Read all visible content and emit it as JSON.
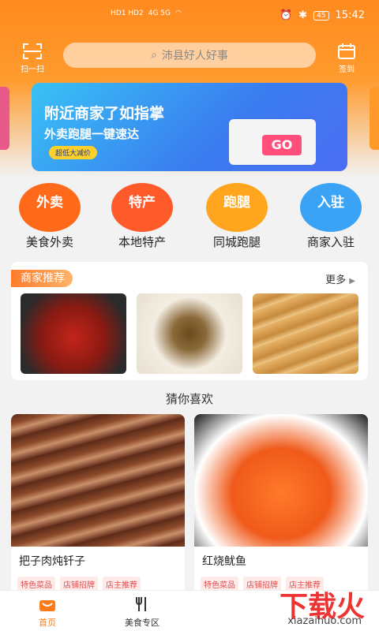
{
  "status": {
    "carrier_tags": "HD1 HD2",
    "signal": "4G 5G",
    "battery": "45",
    "time": "15:42"
  },
  "header": {
    "scan_label": "扫一扫",
    "sign_label": "签到",
    "search_placeholder": "沛县好人好事"
  },
  "banner": {
    "line1": "附近商家了如指掌",
    "line2": "外卖跑腿一键速达",
    "badge": "超低大减价",
    "go_text": "GO"
  },
  "categories": [
    {
      "circle_text": "外卖",
      "label": "美食外卖",
      "color": "#ff6a1a"
    },
    {
      "circle_text": "特产",
      "label": "本地特产",
      "color": "#ff5a2a"
    },
    {
      "circle_text": "跑腿",
      "label": "同城跑腿",
      "color": "#ffa51e"
    },
    {
      "circle_text": "入驻",
      "label": "商家入驻",
      "color": "#3aa3f5"
    }
  ],
  "merchant": {
    "title": "商家推荐",
    "more": "更多"
  },
  "guess": {
    "title": "猜你喜欢"
  },
  "cards": [
    {
      "name": "把子肉炖钎子",
      "tags": [
        "特色菜品",
        "店铺招牌",
        "店主推荐"
      ]
    },
    {
      "name": "红烧鱿鱼",
      "tags": [
        "特色菜品",
        "店铺招牌",
        "店主推荐"
      ]
    }
  ],
  "tabbar": {
    "home": "首页",
    "food": "美食专区"
  },
  "watermark": {
    "main": "下载火",
    "sub": "xiazaihuo.com"
  },
  "colors": {
    "accent": "#ff8a1e",
    "tab_active": "#ff7a1a"
  }
}
